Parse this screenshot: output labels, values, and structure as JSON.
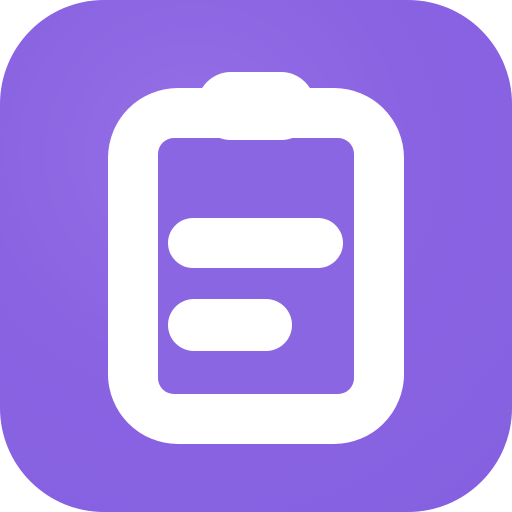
{
  "icon": {
    "symbol": "clipboard-icon",
    "background_color": "#8B66E3",
    "glyph_color": "#FFFFFF"
  }
}
